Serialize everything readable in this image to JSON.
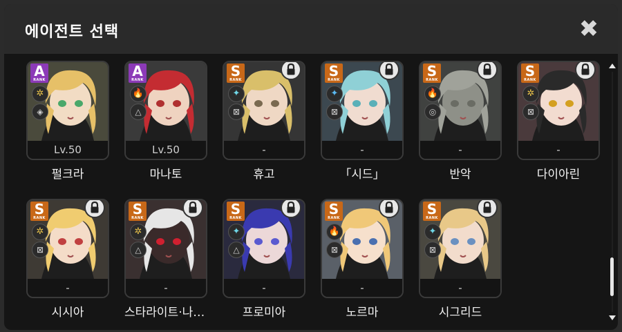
{
  "dialog": {
    "title": "에이전트 선택",
    "close_symbol": "✖"
  },
  "agents": [
    {
      "name": "펄크라",
      "rank": "A",
      "rank_sub": "RANK",
      "level": "Lv.50",
      "locked": false,
      "attr_icon": "physical-icon",
      "attr_glyph": "✲",
      "attr_color": "#e8c24a",
      "class_icon": "defense-icon",
      "class_glyph": "◈",
      "art": {
        "hair": "#e6c068",
        "skin": "#f2dcc4",
        "bg": "#4a4a3c",
        "eye": "#4aa86a"
      }
    },
    {
      "name": "마나토",
      "rank": "A",
      "rank_sub": "RANK",
      "level": "Lv.50",
      "locked": false,
      "attr_icon": "fire-icon",
      "attr_glyph": "🔥",
      "attr_color": "#ff6a3a",
      "class_icon": "attack-icon",
      "class_glyph": "△",
      "art": {
        "hair": "#c42c32",
        "skin": "#efd3c0",
        "bg": "#3a3a3a",
        "eye": "#b03030"
      }
    },
    {
      "name": "휴고",
      "rank": "S",
      "rank_sub": "RANK",
      "level": "-",
      "locked": true,
      "attr_icon": "ice-icon",
      "attr_glyph": "✦",
      "attr_color": "#6fd6e6",
      "class_icon": "anomaly-icon",
      "class_glyph": "⊠",
      "art": {
        "hair": "#d9bf6a",
        "skin": "#efd8c4",
        "bg": "#353535",
        "eye": "#7a6a50"
      }
    },
    {
      "name": "「시드」",
      "rank": "S",
      "rank_sub": "RANK",
      "level": "-",
      "locked": true,
      "attr_icon": "ice-icon",
      "attr_glyph": "✦",
      "attr_color": "#5ab8f0",
      "class_icon": "anomaly-icon",
      "class_glyph": "⊠",
      "art": {
        "hair": "#8fd0d6",
        "skin": "#f0dcd0",
        "bg": "#3c4850",
        "eye": "#5ab0b8"
      }
    },
    {
      "name": "반악",
      "rank": "S",
      "rank_sub": "RANK",
      "level": "-",
      "locked": true,
      "attr_icon": "fire-icon",
      "attr_glyph": "🔥",
      "attr_color": "#ff6a3a",
      "class_icon": "defense-icon",
      "class_glyph": "◎",
      "art": {
        "hair": "#a0a29a",
        "skin": "#8e9088",
        "bg": "#404240",
        "eye": "#6a6c64"
      }
    },
    {
      "name": "다이아린",
      "rank": "S",
      "rank_sub": "RANK",
      "level": "-",
      "locked": true,
      "attr_icon": "physical-icon",
      "attr_glyph": "✲",
      "attr_color": "#e8c24a",
      "class_icon": "anomaly-icon",
      "class_glyph": "⊠",
      "art": {
        "hair": "#2a2a2a",
        "skin": "#f2dcd0",
        "bg": "#4a3a3c",
        "eye": "#d4a020"
      }
    },
    {
      "name": "시시아",
      "rank": "S",
      "rank_sub": "RANK",
      "level": "-",
      "locked": true,
      "attr_icon": "physical-icon",
      "attr_glyph": "✲",
      "attr_color": "#e8c24a",
      "class_icon": "anomaly-icon",
      "class_glyph": "⊠",
      "art": {
        "hair": "#f0cc70",
        "skin": "#f4dcc8",
        "bg": "#3e3a34",
        "eye": "#c04040"
      }
    },
    {
      "name": "스타라이트·나이트",
      "rank": "S",
      "rank_sub": "RANK",
      "level": "-",
      "locked": true,
      "attr_icon": "physical-icon",
      "attr_glyph": "✲",
      "attr_color": "#e8c24a",
      "class_icon": "attack-icon",
      "class_glyph": "△",
      "art": {
        "hair": "#e6e6e6",
        "skin": "#3a2a2a",
        "bg": "#3a3030",
        "eye": "#d02030"
      }
    },
    {
      "name": "프로미아",
      "rank": "S",
      "rank_sub": "RANK",
      "level": "-",
      "locked": true,
      "attr_icon": "ice-icon",
      "attr_glyph": "✦",
      "attr_color": "#6fd6e6",
      "class_icon": "attack-icon",
      "class_glyph": "△",
      "art": {
        "hair": "#3a3ab0",
        "skin": "#ecd8d8",
        "bg": "#2a2a3e",
        "eye": "#5a5ad0"
      }
    },
    {
      "name": "노르마",
      "rank": "S",
      "rank_sub": "RANK",
      "level": "-",
      "locked": true,
      "attr_icon": "fire-icon",
      "attr_glyph": "🔥",
      "attr_color": "#ff6a3a",
      "class_icon": "anomaly-icon",
      "class_glyph": "⊠",
      "art": {
        "hair": "#f0c878",
        "skin": "#f6e0cc",
        "bg": "#5a6068",
        "eye": "#4a70b0"
      }
    },
    {
      "name": "시그리드",
      "rank": "S",
      "rank_sub": "RANK",
      "level": "-",
      "locked": true,
      "attr_icon": "ice-icon",
      "attr_glyph": "✦",
      "attr_color": "#6fd6e6",
      "class_icon": "anomaly-icon",
      "class_glyph": "⊠",
      "art": {
        "hair": "#e8c888",
        "skin": "#f2dccc",
        "bg": "#4a4840",
        "eye": "#6a90c0"
      }
    }
  ],
  "scrollbar": {
    "position": 0.92
  }
}
